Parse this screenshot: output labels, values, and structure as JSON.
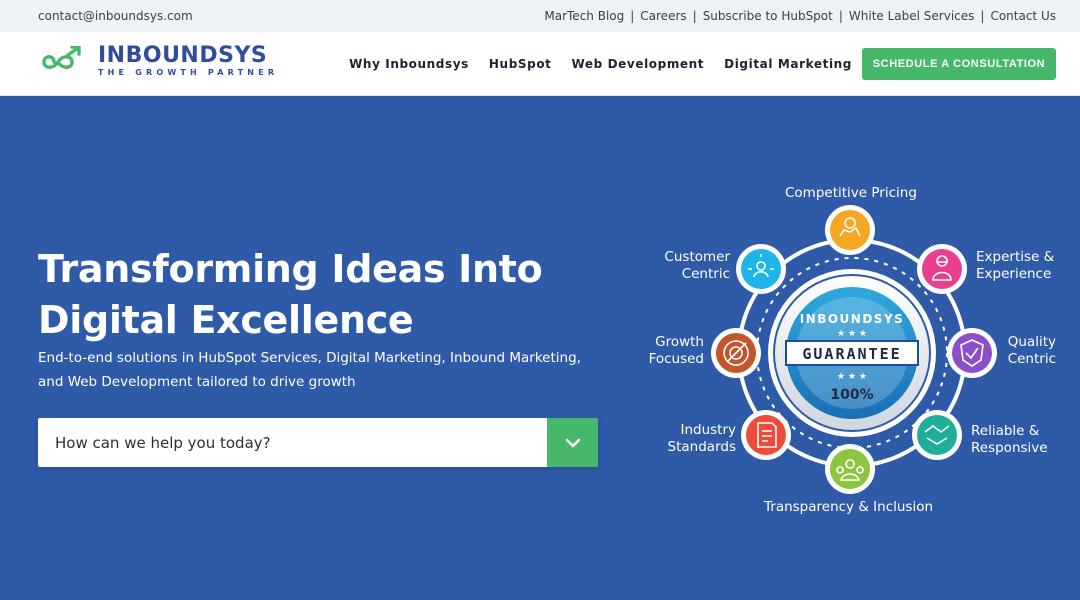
{
  "topbar": {
    "email": "contact@inboundsys.com",
    "links": [
      "MarTech Blog",
      "Careers",
      "Subscribe to HubSpot",
      "White Label Services",
      "Contact Us"
    ]
  },
  "logo": {
    "name": "INBOUNDSYS",
    "tagline": "THE GROWTH PARTNER",
    "icon": "infinity-growth-icon",
    "color": "#2f4d9c",
    "accent": "#47b86a"
  },
  "nav": {
    "items": [
      "Why Inboundsys",
      "HubSpot",
      "Web Development",
      "Digital Marketing"
    ],
    "cta": "SCHEDULE A CONSULTATION"
  },
  "hero": {
    "title_line1": "Transforming Ideas Into",
    "title_line2": "Digital Excellence",
    "subtitle_line1": "End-to-end solutions in HubSpot Services, Digital Marketing, Inbound Marketing,",
    "subtitle_line2": "and Web Development tailored to drive growth",
    "background": "#2f5aa8"
  },
  "help_select": {
    "value": "How can we help you today?",
    "icon": "chevron-down-icon"
  },
  "badge": {
    "top": "INBOUNDSYS",
    "middle": "GUARANTEE",
    "bottom": "100%"
  },
  "features": [
    {
      "line1": "Competitive Pricing",
      "line2": "",
      "color": "#f5a623",
      "icon": "hand-coin-icon"
    },
    {
      "line1": "Expertise &",
      "line2": "Experience",
      "color": "#e8408f",
      "icon": "expert-icon"
    },
    {
      "line1": "Quality",
      "line2": "Centric",
      "color": "#8d4fc9",
      "icon": "quality-shield-icon"
    },
    {
      "line1": "Reliable &",
      "line2": "Responsive",
      "color": "#1fae9a",
      "icon": "handshake-icon"
    },
    {
      "line1": "Transparency & Inclusion",
      "line2": "",
      "color": "#8cc63f",
      "icon": "group-icon"
    },
    {
      "line1": "Industry",
      "line2": "Standards",
      "color": "#ee4b3b",
      "icon": "document-icon"
    },
    {
      "line1": "Growth",
      "line2": "Focused",
      "color": "#c2552b",
      "icon": "target-icon"
    },
    {
      "line1": "Customer",
      "line2": "Centric",
      "color": "#1fb5e8",
      "icon": "customer-icon"
    }
  ]
}
